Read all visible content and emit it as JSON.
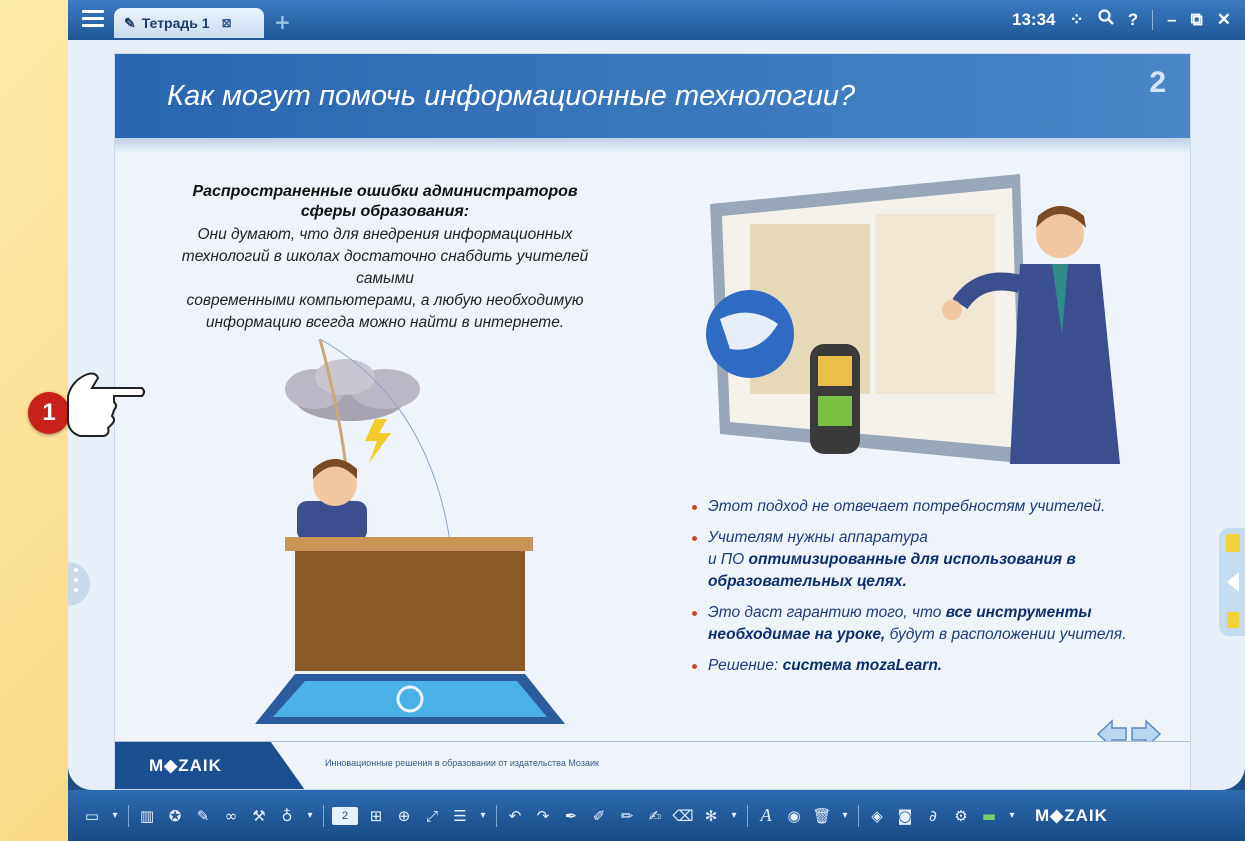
{
  "window": {
    "tab_title": "Тетрадь 1",
    "tab_close": "⊠",
    "new_tab": "+",
    "clock": "13:34",
    "icons": [
      "menu-icon",
      "apps-icon",
      "search-icon",
      "help-icon",
      "minimize-icon",
      "restore-icon",
      "close-icon"
    ]
  },
  "slide": {
    "title": "Как могут помочь информационные технологии?",
    "number": "2",
    "lead_heading_line1": "Распространенные ошибки администраторов",
    "lead_heading_line2": "сферы образования:",
    "lead_body_line1": "Они думают, что для внедрения информационных",
    "lead_body_line2": "технологий в школах достаточно снабдить учителей самыми",
    "lead_body_line3": "современными компьютерами, а любую необходимую",
    "lead_body_line4": "информацию всегда можно найти в интернете.",
    "bullets": {
      "b1": "Этот подход не отвечает потребностям учителей.",
      "b2_pre": "Учителям нужны аппаратура",
      "b2_mid": "и ПО",
      "b2_bold": "оптимизированные для использования в образовательных целях.",
      "b3_pre": "Это даст гарантию того, что",
      "b3_bold": "все инструменты необходимае на уроке,",
      "b3_post": "будут в расположении учителя.",
      "b4_pre": "Решение:",
      "b4_bold": "система mozaLearn."
    },
    "footer_logo": "M◆ZAIK",
    "footer_text": "Инновационные решения в образовании от издательства Мозаик"
  },
  "callout": {
    "number": "1"
  },
  "toolbar": {
    "page_number": "2",
    "logo": "M◆ZAIK"
  },
  "colors": {
    "titlebar": "#2a62a8",
    "slide_header": "#2a66b0",
    "accent_red": "#c8211b",
    "bullet_text": "#1c3d7a"
  }
}
